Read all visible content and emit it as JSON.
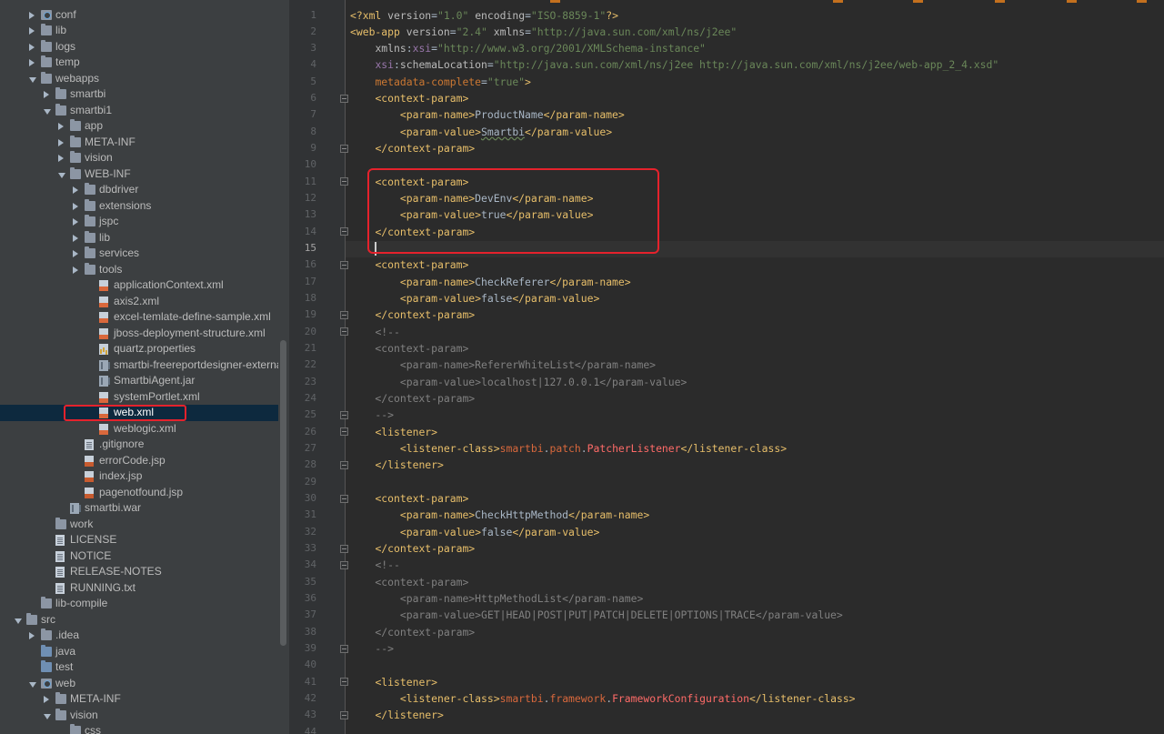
{
  "tree": {
    "items": [
      {
        "label": "conf",
        "icon": "folder-gear-icon",
        "indent": 1,
        "expand": "right"
      },
      {
        "label": "lib",
        "icon": "folder-icon",
        "indent": 1,
        "expand": "right"
      },
      {
        "label": "logs",
        "icon": "folder-icon",
        "indent": 1,
        "expand": "right"
      },
      {
        "label": "temp",
        "icon": "folder-icon",
        "indent": 1,
        "expand": "right"
      },
      {
        "label": "webapps",
        "icon": "folder-icon",
        "indent": 1,
        "expand": "down"
      },
      {
        "label": "smartbi",
        "icon": "folder-icon",
        "indent": 2,
        "expand": "right"
      },
      {
        "label": "smartbi1",
        "icon": "folder-icon",
        "indent": 2,
        "expand": "down"
      },
      {
        "label": "app",
        "icon": "folder-icon",
        "indent": 3,
        "expand": "right"
      },
      {
        "label": "META-INF",
        "icon": "folder-icon",
        "indent": 3,
        "expand": "right"
      },
      {
        "label": "vision",
        "icon": "folder-icon",
        "indent": 3,
        "expand": "right"
      },
      {
        "label": "WEB-INF",
        "icon": "folder-icon",
        "indent": 3,
        "expand": "down"
      },
      {
        "label": "dbdriver",
        "icon": "folder-icon",
        "indent": 4,
        "expand": "right"
      },
      {
        "label": "extensions",
        "icon": "folder-icon",
        "indent": 4,
        "expand": "right"
      },
      {
        "label": "jspc",
        "icon": "folder-icon",
        "indent": 4,
        "expand": "right"
      },
      {
        "label": "lib",
        "icon": "folder-icon",
        "indent": 4,
        "expand": "right"
      },
      {
        "label": "services",
        "icon": "folder-icon",
        "indent": 4,
        "expand": "right"
      },
      {
        "label": "tools",
        "icon": "folder-icon",
        "indent": 4,
        "expand": "right"
      },
      {
        "label": "applicationContext.xml",
        "icon": "xml-file-icon",
        "indent": 5,
        "expand": ""
      },
      {
        "label": "axis2.xml",
        "icon": "xml-file-icon",
        "indent": 5,
        "expand": ""
      },
      {
        "label": "excel-temlate-define-sample.xml",
        "icon": "xml-file-icon",
        "indent": 5,
        "expand": ""
      },
      {
        "label": "jboss-deployment-structure.xml",
        "icon": "xml-file-icon",
        "indent": 5,
        "expand": ""
      },
      {
        "label": "quartz.properties",
        "icon": "properties-file-icon",
        "indent": 5,
        "expand": ""
      },
      {
        "label": "smartbi-freereportdesigner-external.jar",
        "icon": "jar-file-icon",
        "indent": 5,
        "expand": ""
      },
      {
        "label": "SmartbiAgent.jar",
        "icon": "jar-file-icon",
        "indent": 5,
        "expand": ""
      },
      {
        "label": "systemPortlet.xml",
        "icon": "xml-file-icon",
        "indent": 5,
        "expand": ""
      },
      {
        "label": "web.xml",
        "icon": "xml-file-icon",
        "indent": 5,
        "expand": "",
        "selected": true
      },
      {
        "label": "weblogic.xml",
        "icon": "xml-file-icon",
        "indent": 5,
        "expand": ""
      },
      {
        "label": ".gitignore",
        "icon": "text-file-icon",
        "indent": 4,
        "expand": ""
      },
      {
        "label": "errorCode.jsp",
        "icon": "jsp-file-icon",
        "indent": 4,
        "expand": ""
      },
      {
        "label": "index.jsp",
        "icon": "jsp-file-icon",
        "indent": 4,
        "expand": ""
      },
      {
        "label": "pagenotfound.jsp",
        "icon": "jsp-file-icon",
        "indent": 4,
        "expand": ""
      },
      {
        "label": "smartbi.war",
        "icon": "jar-file-icon",
        "indent": 3,
        "expand": ""
      },
      {
        "label": "work",
        "icon": "folder-icon",
        "indent": 2,
        "expand": ""
      },
      {
        "label": "LICENSE",
        "icon": "text-file-icon",
        "indent": 2,
        "expand": ""
      },
      {
        "label": "NOTICE",
        "icon": "text-file-icon",
        "indent": 2,
        "expand": ""
      },
      {
        "label": "RELEASE-NOTES",
        "icon": "text-file-icon",
        "indent": 2,
        "expand": ""
      },
      {
        "label": "RUNNING.txt",
        "icon": "text-file-icon",
        "indent": 2,
        "expand": ""
      },
      {
        "label": "lib-compile",
        "icon": "folder-icon",
        "indent": 1,
        "expand": ""
      },
      {
        "label": "src",
        "icon": "folder-icon",
        "indent": 0,
        "expand": "down"
      },
      {
        "label": ".idea",
        "icon": "folder-icon",
        "indent": 1,
        "expand": "right"
      },
      {
        "label": "java",
        "icon": "folder-blue-icon",
        "indent": 1,
        "expand": ""
      },
      {
        "label": "test",
        "icon": "folder-blue-icon",
        "indent": 1,
        "expand": ""
      },
      {
        "label": "web",
        "icon": "folder-gear-icon",
        "indent": 1,
        "expand": "down"
      },
      {
        "label": "META-INF",
        "icon": "folder-icon",
        "indent": 2,
        "expand": "right"
      },
      {
        "label": "vision",
        "icon": "folder-icon",
        "indent": 2,
        "expand": "down"
      },
      {
        "label": "css",
        "icon": "folder-icon",
        "indent": 3,
        "expand": ""
      }
    ]
  },
  "editor": {
    "current_line": 15,
    "lines": [
      {
        "n": "1",
        "tokens": [
          [
            "t-tag",
            "<?xml "
          ],
          [
            "t-attr",
            "version"
          ],
          [
            "t-txt",
            "="
          ],
          [
            "t-val",
            "\"1.0\""
          ],
          [
            "t-txt",
            " "
          ],
          [
            "t-attr",
            "encoding"
          ],
          [
            "t-txt",
            "="
          ],
          [
            "t-val",
            "\"ISO-8859-1\""
          ],
          [
            "t-tag",
            "?>"
          ]
        ]
      },
      {
        "n": "2",
        "tokens": [
          [
            "t-tag",
            "<web-app "
          ],
          [
            "t-attr",
            "version"
          ],
          [
            "t-txt",
            "="
          ],
          [
            "t-val",
            "\"2.4\""
          ],
          [
            "t-txt",
            " "
          ],
          [
            "t-attr",
            "xmlns"
          ],
          [
            "t-txt",
            "="
          ],
          [
            "t-val",
            "\"http://java.sun.com/xml/ns/j2ee\""
          ]
        ]
      },
      {
        "n": "3",
        "tokens": [
          [
            "t-txt",
            "    "
          ],
          [
            "t-attr",
            "xmlns"
          ],
          [
            "t-txt",
            ":"
          ],
          [
            "t-ns",
            "xsi"
          ],
          [
            "t-txt",
            "="
          ],
          [
            "t-val",
            "\"http://www.w3.org/2001/XMLSchema-instance\""
          ]
        ]
      },
      {
        "n": "4",
        "tokens": [
          [
            "t-txt",
            "    "
          ],
          [
            "t-ns",
            "xsi"
          ],
          [
            "t-txt",
            ":"
          ],
          [
            "t-attr",
            "schemaLocation"
          ],
          [
            "t-txt",
            "="
          ],
          [
            "t-val",
            "\"http://java.sun.com/xml/ns/j2ee http://java.sun.com/xml/ns/j2ee/web-app_2_4.xsd\""
          ]
        ]
      },
      {
        "n": "5",
        "tokens": [
          [
            "t-txt",
            "    "
          ],
          [
            "t-red",
            "metadata-complete"
          ],
          [
            "t-txt",
            "="
          ],
          [
            "t-val",
            "\"true\""
          ],
          [
            "t-tag",
            ">"
          ]
        ]
      },
      {
        "n": "6",
        "tokens": [
          [
            "t-txt",
            "    "
          ],
          [
            "t-tag",
            "<context-param>"
          ]
        ]
      },
      {
        "n": "7",
        "tokens": [
          [
            "t-txt",
            "        "
          ],
          [
            "t-tag",
            "<param-name>"
          ],
          [
            "t-txt",
            "ProductName"
          ],
          [
            "t-tag",
            "</param-name>"
          ]
        ]
      },
      {
        "n": "8",
        "tokens": [
          [
            "t-txt",
            "        "
          ],
          [
            "t-tag",
            "<param-value>"
          ],
          [
            "t-txt uline",
            "Smartbi"
          ],
          [
            "t-tag",
            "</param-value>"
          ]
        ]
      },
      {
        "n": "9",
        "tokens": [
          [
            "t-txt",
            "    "
          ],
          [
            "t-tag",
            "</context-param>"
          ]
        ]
      },
      {
        "n": "10",
        "tokens": []
      },
      {
        "n": "11",
        "tokens": [
          [
            "t-txt",
            "    "
          ],
          [
            "t-tag",
            "<context-param>"
          ]
        ]
      },
      {
        "n": "12",
        "tokens": [
          [
            "t-txt",
            "        "
          ],
          [
            "t-tag",
            "<param-name>"
          ],
          [
            "t-txt",
            "DevEnv"
          ],
          [
            "t-tag",
            "</param-name>"
          ]
        ]
      },
      {
        "n": "13",
        "tokens": [
          [
            "t-txt",
            "        "
          ],
          [
            "t-tag",
            "<param-value>"
          ],
          [
            "t-txt",
            "true"
          ],
          [
            "t-tag",
            "</param-value>"
          ]
        ]
      },
      {
        "n": "14",
        "tokens": [
          [
            "t-txt",
            "    "
          ],
          [
            "t-tag",
            "</context-param>"
          ]
        ]
      },
      {
        "n": "15",
        "tokens": []
      },
      {
        "n": "16",
        "tokens": [
          [
            "t-txt",
            "    "
          ],
          [
            "t-tag",
            "<context-param>"
          ]
        ]
      },
      {
        "n": "17",
        "tokens": [
          [
            "t-txt",
            "        "
          ],
          [
            "t-tag",
            "<param-name>"
          ],
          [
            "t-txt",
            "CheckReferer"
          ],
          [
            "t-tag",
            "</param-name>"
          ]
        ]
      },
      {
        "n": "18",
        "tokens": [
          [
            "t-txt",
            "        "
          ],
          [
            "t-tag",
            "<param-value>"
          ],
          [
            "t-txt",
            "false"
          ],
          [
            "t-tag",
            "</param-value>"
          ]
        ]
      },
      {
        "n": "19",
        "tokens": [
          [
            "t-txt",
            "    "
          ],
          [
            "t-tag",
            "</context-param>"
          ]
        ]
      },
      {
        "n": "20",
        "tokens": [
          [
            "t-txt",
            "    "
          ],
          [
            "t-com",
            "<!--"
          ]
        ]
      },
      {
        "n": "21",
        "tokens": [
          [
            "t-com",
            "    <context-param>"
          ]
        ]
      },
      {
        "n": "22",
        "tokens": [
          [
            "t-com",
            "        <param-name>RefererWhiteList</param-name>"
          ]
        ]
      },
      {
        "n": "23",
        "tokens": [
          [
            "t-com",
            "        <param-value>localhost|127.0.0.1</param-value>"
          ]
        ]
      },
      {
        "n": "24",
        "tokens": [
          [
            "t-com",
            "    </context-param>"
          ]
        ]
      },
      {
        "n": "25",
        "tokens": [
          [
            "t-com",
            "    -->"
          ]
        ]
      },
      {
        "n": "26",
        "tokens": [
          [
            "t-txt",
            "    "
          ],
          [
            "t-tag",
            "<listener>"
          ]
        ]
      },
      {
        "n": "27",
        "tokens": [
          [
            "t-txt",
            "        "
          ],
          [
            "t-tag",
            "<listener-class>"
          ],
          [
            "t-pkg",
            "smartbi"
          ],
          [
            "t-dot",
            "."
          ],
          [
            "t-pkg",
            "patch"
          ],
          [
            "t-dot",
            "."
          ],
          [
            "t-cls",
            "PatcherListener"
          ],
          [
            "t-tag",
            "</listener-class>"
          ]
        ]
      },
      {
        "n": "28",
        "tokens": [
          [
            "t-txt",
            "    "
          ],
          [
            "t-tag",
            "</listener>"
          ]
        ]
      },
      {
        "n": "29",
        "tokens": []
      },
      {
        "n": "30",
        "tokens": [
          [
            "t-txt",
            "    "
          ],
          [
            "t-tag",
            "<context-param>"
          ]
        ]
      },
      {
        "n": "31",
        "tokens": [
          [
            "t-txt",
            "        "
          ],
          [
            "t-tag",
            "<param-name>"
          ],
          [
            "t-txt",
            "CheckHttpMethod"
          ],
          [
            "t-tag",
            "</param-name>"
          ]
        ]
      },
      {
        "n": "32",
        "tokens": [
          [
            "t-txt",
            "        "
          ],
          [
            "t-tag",
            "<param-value>"
          ],
          [
            "t-txt",
            "false"
          ],
          [
            "t-tag",
            "</param-value>"
          ]
        ]
      },
      {
        "n": "33",
        "tokens": [
          [
            "t-txt",
            "    "
          ],
          [
            "t-tag",
            "</context-param>"
          ]
        ]
      },
      {
        "n": "34",
        "tokens": [
          [
            "t-txt",
            "    "
          ],
          [
            "t-com",
            "<!--"
          ]
        ]
      },
      {
        "n": "35",
        "tokens": [
          [
            "t-com",
            "    <context-param>"
          ]
        ]
      },
      {
        "n": "36",
        "tokens": [
          [
            "t-com",
            "        <param-name>HttpMethodList</param-name>"
          ]
        ]
      },
      {
        "n": "37",
        "tokens": [
          [
            "t-com",
            "        <param-value>GET|HEAD|POST|PUT|PATCH|DELETE|OPTIONS|TRACE</param-value>"
          ]
        ]
      },
      {
        "n": "38",
        "tokens": [
          [
            "t-com",
            "    </context-param>"
          ]
        ]
      },
      {
        "n": "39",
        "tokens": [
          [
            "t-com",
            "    -->"
          ]
        ]
      },
      {
        "n": "40",
        "tokens": []
      },
      {
        "n": "41",
        "tokens": [
          [
            "t-txt",
            "    "
          ],
          [
            "t-tag",
            "<listener>"
          ]
        ]
      },
      {
        "n": "42",
        "tokens": [
          [
            "t-txt",
            "        "
          ],
          [
            "t-tag",
            "<listener-class>"
          ],
          [
            "t-pkg",
            "smartbi"
          ],
          [
            "t-dot",
            "."
          ],
          [
            "t-pkg",
            "framework"
          ],
          [
            "t-dot",
            "."
          ],
          [
            "t-cls",
            "FrameworkConfiguration"
          ],
          [
            "t-tag",
            "</listener-class>"
          ]
        ]
      },
      {
        "n": "43",
        "tokens": [
          [
            "t-txt",
            "    "
          ],
          [
            "t-tag",
            "</listener>"
          ]
        ]
      },
      {
        "n": "44",
        "tokens": []
      }
    ],
    "fold_lines": [
      6,
      9,
      11,
      14,
      16,
      19,
      20,
      25,
      26,
      28,
      30,
      33,
      34,
      39,
      41,
      43
    ]
  },
  "colors": {
    "highlight_border": "#e5222c",
    "tree_bg": "#3c3f41",
    "editor_bg": "#2b2b2b",
    "tag": "#e8bf6a",
    "string": "#6a8759",
    "comment": "#808080"
  }
}
